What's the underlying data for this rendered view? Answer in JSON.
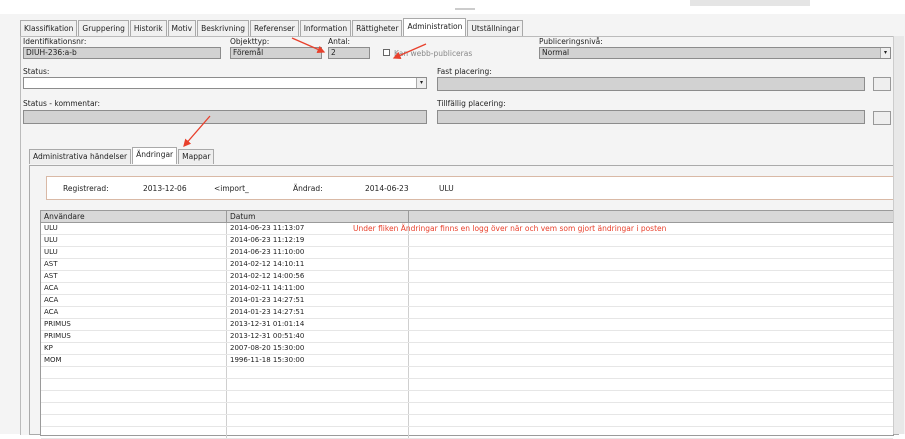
{
  "main_tabs": [
    {
      "label": "Klassifikation"
    },
    {
      "label": "Gruppering"
    },
    {
      "label": "Historik"
    },
    {
      "label": "Motiv"
    },
    {
      "label": "Beskrivning"
    },
    {
      "label": "Referenser"
    },
    {
      "label": "Information"
    },
    {
      "label": "Rättigheter"
    },
    {
      "label": "Administration",
      "active": true
    },
    {
      "label": "Utställningar"
    }
  ],
  "form": {
    "identifikation_label": "Identifikationsnr:",
    "identifikation_value": "DIUH-236:a-b",
    "objekttyp_label": "Objekttyp:",
    "objekttyp_value": "Föremål",
    "antal_label": "Antal:",
    "antal_value": "2",
    "webb_label": "Kan webb-publiceras",
    "publicering_label": "Publiceringsnivå:",
    "publicering_value": "Normal",
    "status_label": "Status:",
    "status_value": "",
    "fast_label": "Fast placering:",
    "status_kommentar_label": "Status - kommentar:",
    "tillfallig_label": "Tillfällig placering:"
  },
  "sub_tabs": [
    {
      "label": "Administrativa händelser"
    },
    {
      "label": "Ändringar",
      "active": true
    },
    {
      "label": "Mappar"
    }
  ],
  "registration": {
    "registrerad_label": "Registrerad:",
    "registrerad_date": "2013-12-06",
    "registrerad_by": "<import_",
    "andrad_label": "Ändrad:",
    "andrad_date": "2014-06-23",
    "andrad_by": "ULU"
  },
  "table": {
    "columns": [
      "Användare",
      "Datum",
      ""
    ],
    "rows": [
      [
        "ULU",
        "2014-06-23 11:13:07"
      ],
      [
        "ULU",
        "2014-06-23 11:12:19"
      ],
      [
        "ULU",
        "2014-06-23 11:10:00"
      ],
      [
        "AST",
        "2014-02-12 14:10:11"
      ],
      [
        "AST",
        "2014-02-12 14:00:56"
      ],
      [
        "ACA",
        "2014-02-11 14:11:00"
      ],
      [
        "ACA",
        "2014-01-23 14:27:51"
      ],
      [
        "ACA",
        "2014-01-23 14:27:51"
      ],
      [
        "PRIMUS",
        "2013-12-31 01:01:14"
      ],
      [
        "PRIMUS",
        "2013-12-31 00:51:40"
      ],
      [
        "KP",
        "2007-08-20 15:30:00"
      ],
      [
        "MOM",
        "1996-11-18 15:30:00"
      ]
    ]
  },
  "annotation": "Under fliken Ändringar finns en logg över när och vem som gjort ändringar i posten",
  "colors": {
    "annotation": "#e8402c",
    "field_bg": "#d2d2d2"
  }
}
